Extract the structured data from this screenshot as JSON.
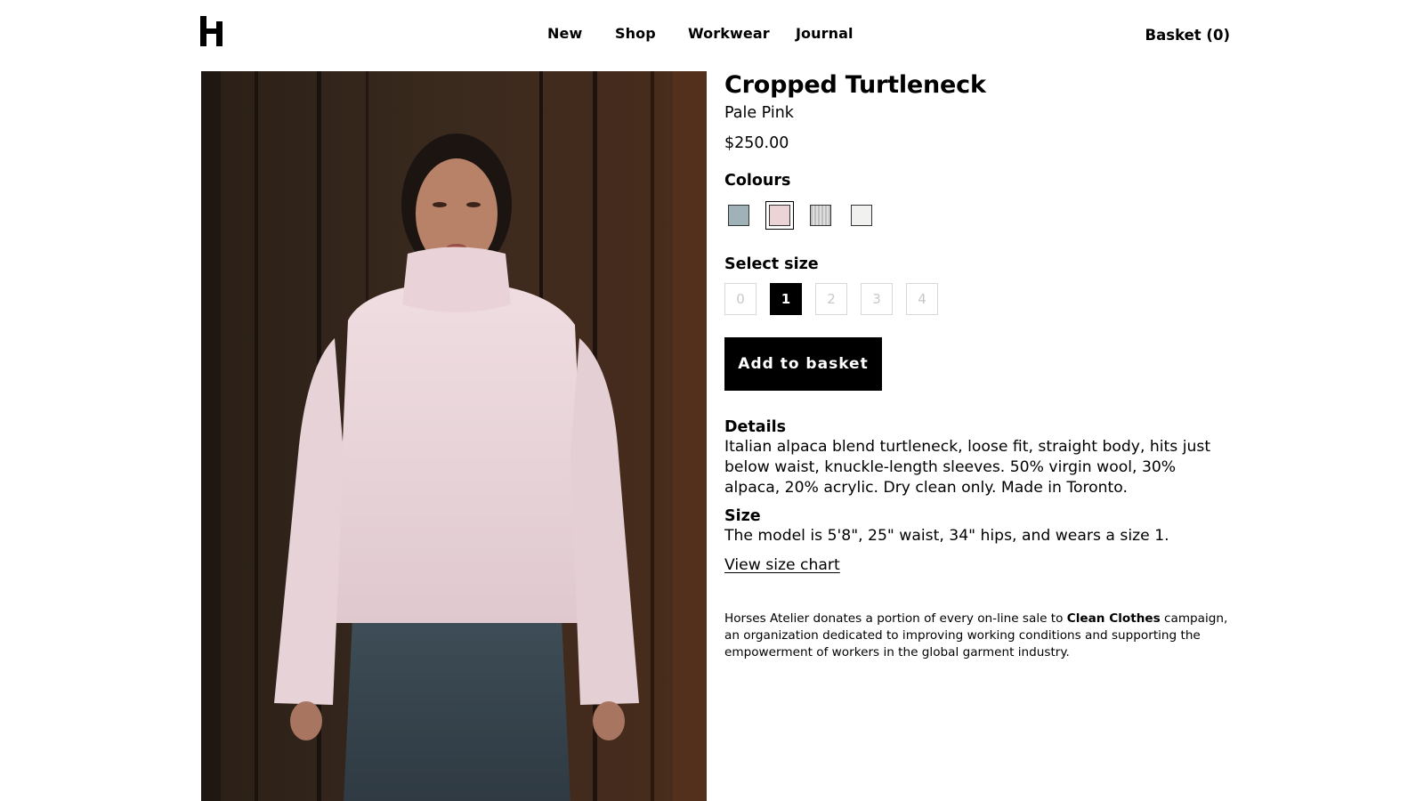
{
  "header": {
    "logo_text": "H",
    "nav": [
      {
        "label": "New"
      },
      {
        "label": "Shop"
      },
      {
        "label": "Workwear"
      },
      {
        "label": "Journal"
      }
    ],
    "basket_label": "Basket (0)"
  },
  "product": {
    "title": "Cropped Turtleneck",
    "colour_name": "Pale Pink",
    "price": "$250.00",
    "colours_heading": "Colours",
    "colours": [
      {
        "name": "slate-blue",
        "hex": "#9fb2b8",
        "selected": false
      },
      {
        "name": "pale-pink",
        "hex": "#ecd4d6",
        "selected": true
      },
      {
        "name": "grey-stripe",
        "hex": "#c9c9c9",
        "selected": false
      },
      {
        "name": "ivory",
        "hex": "#f1f1ef",
        "selected": false
      }
    ],
    "size_heading": "Select size",
    "sizes": [
      {
        "label": "0",
        "selected": false
      },
      {
        "label": "1",
        "selected": true
      },
      {
        "label": "2",
        "selected": false
      },
      {
        "label": "3",
        "selected": false
      },
      {
        "label": "4",
        "selected": false
      }
    ],
    "add_button": "Add to basket",
    "details_heading": "Details",
    "details_text": "Italian alpaca blend turtleneck, loose fit, straight body, hits just below waist, knuckle-length sleeves. 50% virgin wool, 30% alpaca, 20% acrylic. Dry clean only. Made in Toronto.",
    "size_info_heading": "Size",
    "size_info_text": "The model is 5'8\", 25\" waist, 34\" hips, and wears a size 1.",
    "size_chart_link": "View size chart",
    "donation_before": "Horses Atelier donates a portion of every on-line sale to ",
    "donation_bold": "Clean Clothes",
    "donation_after": " campaign, an organization dedicated to improving working conditions and supporting the empowerment of workers in the global garment industry."
  },
  "colors": {
    "accent": "#000000",
    "background": "#ffffff",
    "disabled_size": "#c8c8c8"
  }
}
